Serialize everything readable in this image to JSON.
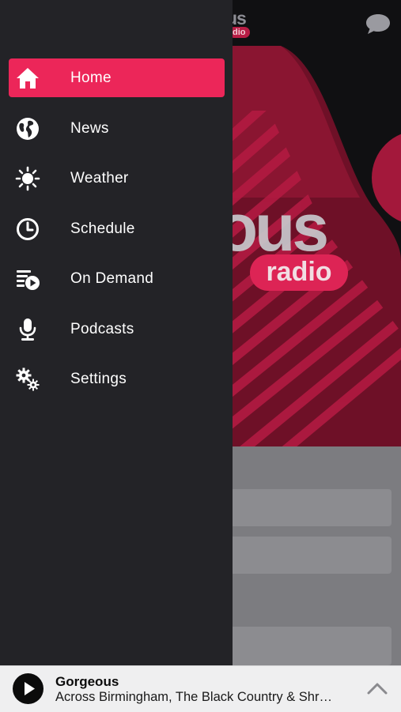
{
  "brand": {
    "small_word": "us",
    "small_tag": "dio",
    "big_word": "eous",
    "big_tag": "radio",
    "accent": "#ec2659"
  },
  "menu": {
    "items": [
      {
        "label": "Home",
        "icon": "home-icon",
        "active": true
      },
      {
        "label": "News",
        "icon": "globe-icon"
      },
      {
        "label": "Weather",
        "icon": "sun-icon"
      },
      {
        "label": "Schedule",
        "icon": "clock-icon"
      },
      {
        "label": "On Demand",
        "icon": "playlist-play-icon"
      },
      {
        "label": "Podcasts",
        "icon": "microphone-icon"
      },
      {
        "label": "Settings",
        "icon": "gears-icon"
      }
    ]
  },
  "player": {
    "station": "Gorgeous",
    "show": "Across Birmingham, The Black Country & Shr…"
  }
}
